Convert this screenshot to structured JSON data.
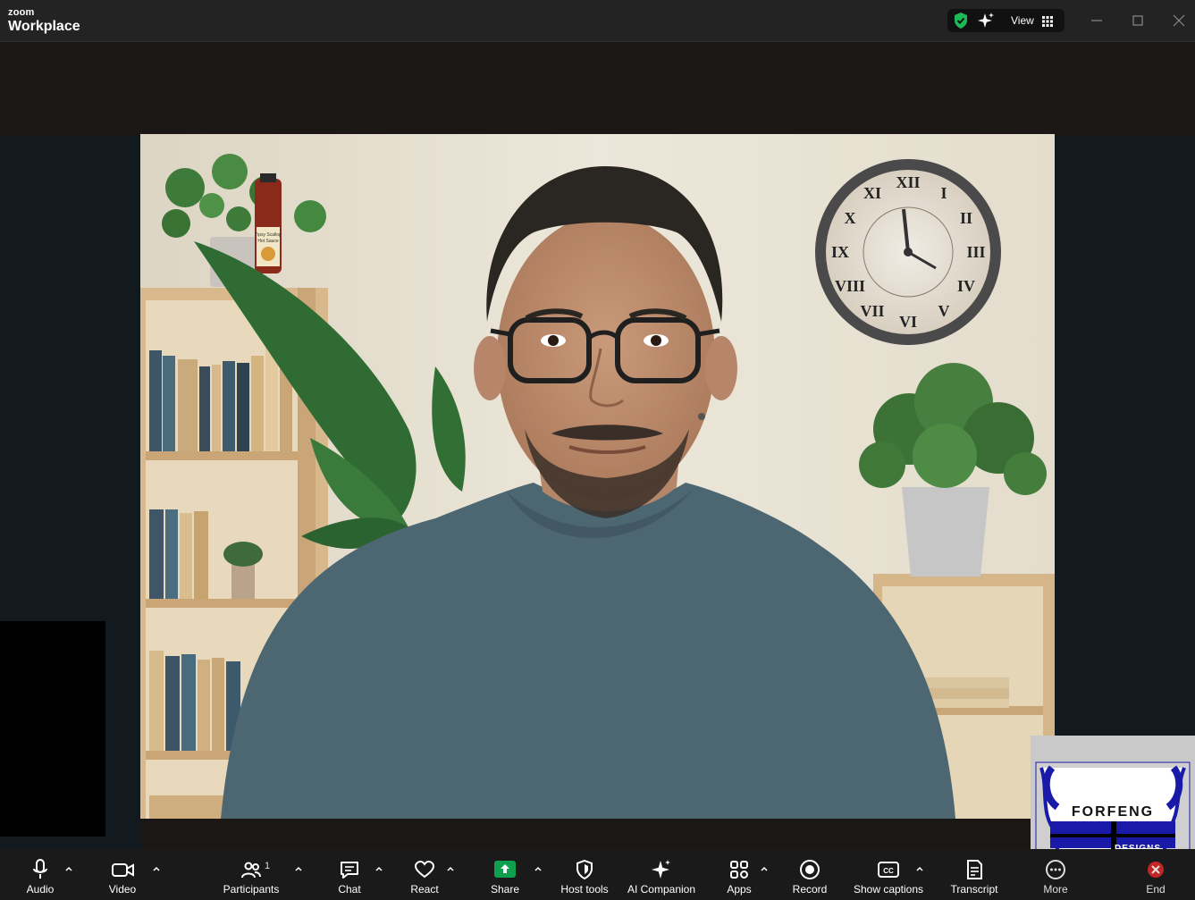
{
  "titlebar": {
    "brand_small": "zoom",
    "brand_big": "Workplace",
    "view_label": "View"
  },
  "icons": {
    "security": "shield-check-icon",
    "ai": "sparkle-icon",
    "view": "grid-icon",
    "minimize": "minimize-icon",
    "maximize": "maximize-icon",
    "close": "close-icon"
  },
  "colors": {
    "security_green": "#1db954",
    "share_green": "#0e9f4f",
    "end_red": "#e02828",
    "logo_blue": "#1a1aa8"
  },
  "video": {
    "product_label_line1": "Tipsy Scallop",
    "product_label_line2": "Hot Sauce"
  },
  "logo": {
    "line1": "FORFENG",
    "line2": "DESIGNS"
  },
  "toolbar": {
    "audio": "Audio",
    "video": "Video",
    "participants": "Participants",
    "participants_count": "1",
    "chat": "Chat",
    "react": "React",
    "share": "Share",
    "host_tools": "Host tools",
    "ai_companion": "AI Companion",
    "apps": "Apps",
    "record": "Record",
    "show_captions": "Show captions",
    "transcript": "Transcript",
    "more": "More",
    "end": "End"
  }
}
